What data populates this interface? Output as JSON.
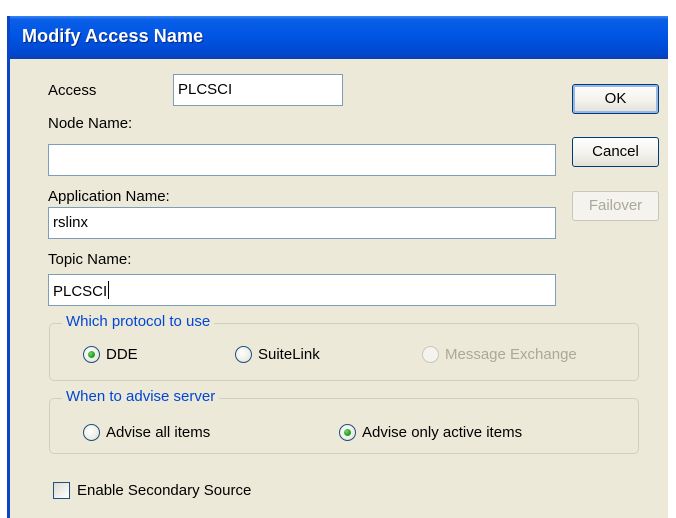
{
  "dialog": {
    "title": "Modify Access Name"
  },
  "fields": {
    "access": {
      "label": "Access",
      "value": "PLCSCI"
    },
    "node_name": {
      "label": "Node Name:",
      "value": ""
    },
    "application_name": {
      "label": "Application Name:",
      "value": "rslinx"
    },
    "topic_name": {
      "label": "Topic Name:",
      "value": "PLCSCI"
    }
  },
  "buttons": {
    "ok": "OK",
    "cancel": "Cancel",
    "failover": "Failover"
  },
  "protocol": {
    "legend": "Which protocol to use",
    "options": [
      {
        "label": "DDE",
        "selected": true,
        "enabled": true
      },
      {
        "label": "SuiteLink",
        "selected": false,
        "enabled": true
      },
      {
        "label": "Message Exchange",
        "selected": false,
        "enabled": false
      }
    ]
  },
  "advise": {
    "legend": "When to advise server",
    "options": [
      {
        "label": "Advise all items",
        "selected": false
      },
      {
        "label": "Advise only active items",
        "selected": true
      }
    ]
  },
  "secondary_source": {
    "label": "Enable Secondary Source",
    "checked": false
  },
  "colors": {
    "title_bar": "#0055e5",
    "group_legend": "#0046d5",
    "dialog_bg": "#ece9d8",
    "radio_dot": "#21a121"
  }
}
